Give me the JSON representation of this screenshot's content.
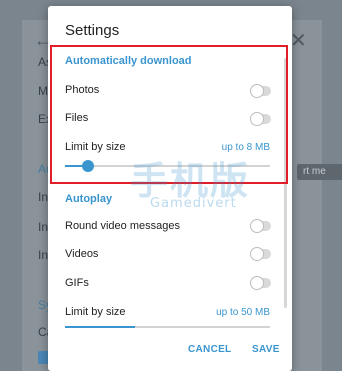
{
  "background": {
    "letters": [
      "As",
      "Ma",
      "Ex",
      "Au",
      "In",
      "In",
      "In",
      "Sy",
      "Ca"
    ],
    "right_pill_text": "rt me"
  },
  "dialog": {
    "title": "Settings",
    "auto_download": {
      "header": "Automatically download",
      "photos_label": "Photos",
      "photos_enabled": false,
      "files_label": "Files",
      "files_enabled": false,
      "limit_label": "Limit by size",
      "limit_value": "up to 8 MB"
    },
    "autoplay": {
      "header": "Autoplay",
      "round_label": "Round video messages",
      "round_enabled": false,
      "videos_label": "Videos",
      "videos_enabled": false,
      "gifs_label": "GIFs",
      "gifs_enabled": false,
      "limit_label": "Limit by size",
      "limit_value": "up to 50 MB"
    },
    "buttons": {
      "cancel": "CANCEL",
      "save": "SAVE"
    }
  },
  "watermark": {
    "text": "手机版",
    "sub": "Gamedivert"
  },
  "colors": {
    "accent": "#3a95cf",
    "highlight": "#e11d27"
  }
}
